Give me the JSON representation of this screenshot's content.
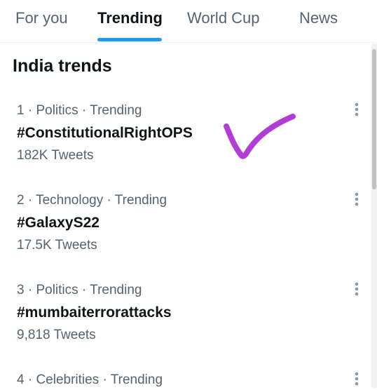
{
  "tabs": [
    {
      "label": "For you"
    },
    {
      "label": "Trending"
    },
    {
      "label": "World Cup"
    },
    {
      "label": "News"
    }
  ],
  "active_tab": "Trending",
  "section_title": "India trends",
  "trends": [
    {
      "meta": "1 · Politics · Trending",
      "name": "#ConstitutionalRightOPS",
      "count": "182K Tweets"
    },
    {
      "meta": "2 · Technology · Trending",
      "name": "#GalaxyS22",
      "count": "17.5K Tweets"
    },
    {
      "meta": "3 · Politics · Trending",
      "name": "#mumbaiterrorattacks",
      "count": "9,818 Tweets"
    },
    {
      "meta": "4 · Celebrities · Trending",
      "name": "",
      "count": ""
    }
  ],
  "annotation": {
    "icon": "handdrawn-checkmark-icon",
    "color": "#b23dd6"
  },
  "colors": {
    "accent": "#1d9bf0",
    "secondary_text": "#536471",
    "primary_text": "#0f1419"
  }
}
